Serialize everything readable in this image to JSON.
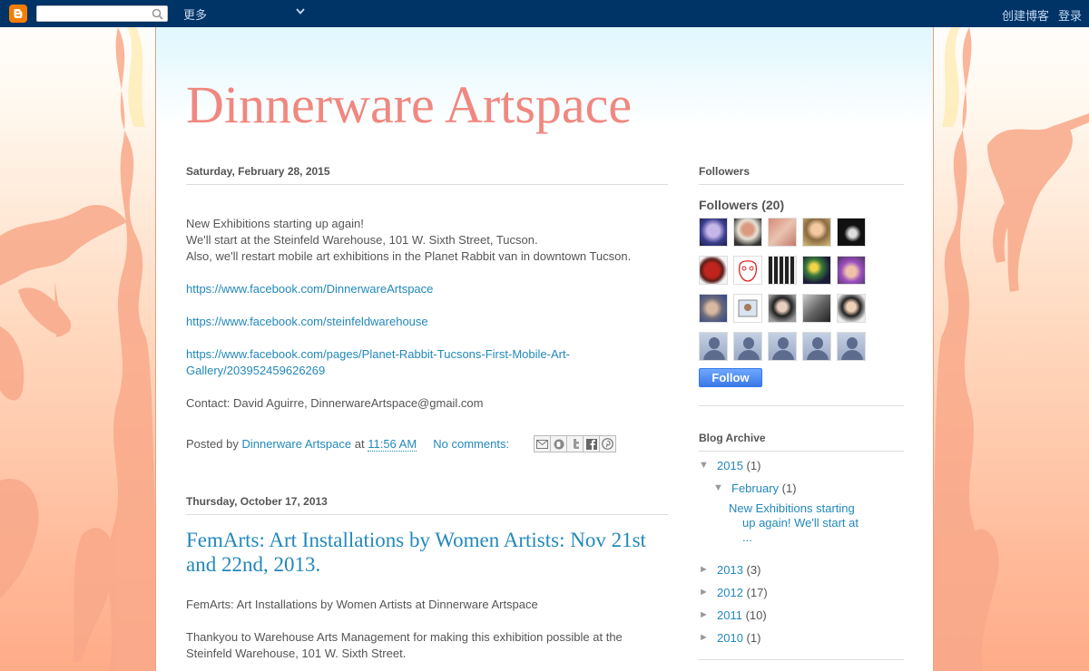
{
  "navbar": {
    "more_label": "更多",
    "create_blog": "创建博客",
    "sign_in": "登录",
    "search_value": ""
  },
  "blog": {
    "title": "Dinnerware Artspace"
  },
  "posts": [
    {
      "date": "Saturday, February 28, 2015",
      "title": "",
      "lines": [
        "New Exhibitions starting up again!",
        "We'll start at the Steinfeld Warehouse, 101 W. Sixth Street, Tucson.",
        "Also, we'll restart mobile art exhibitions in the Planet Rabbit van in downtown Tucson."
      ],
      "link1": "https://www.facebook.com/DinnerwareArtspace",
      "link2": "https://www.facebook.com/steinfeldwarehouse",
      "link3a": "https://www.facebook.com/pages/Planet-Rabbit-Tucsons-First-Mobile-Art-",
      "link3b": "Gallery/203952459626269",
      "contact": "Contact: David Aguirre, DinnerwareArtspace@gmail.com",
      "posted_by_prefix": "Posted by",
      "author": "Dinnerware Artspace",
      "at": "at",
      "time": "11:56 AM",
      "comments": "No comments:"
    },
    {
      "date": "Thursday, October 17, 2013",
      "title": "FemArts: Art Installations by Women Artists: Nov 21st and 22nd, 2013.",
      "line1": "FemArts: Art Installations by Women Artists at Dinnerware Artspace",
      "line2": "Thankyou to Warehouse Arts Management for making this exhibition possible at the",
      "line3": "Steinfeld Warehouse, 101 W. Sixth Street."
    }
  ],
  "sidebar": {
    "followers_title": "Followers",
    "followers_count": "Followers (20)",
    "follow_button": "Follow",
    "archive_title": "Blog Archive",
    "archive": {
      "y2015": {
        "label": "2015",
        "count": "(1)"
      },
      "feb": {
        "label": "February",
        "count": "(1)"
      },
      "post_l1": "New Exhibitions starting",
      "post_l2": "up again! We'll start at",
      "post_l3": "...",
      "y2013": {
        "label": "2013",
        "count": "(3)"
      },
      "y2012": {
        "label": "2012",
        "count": "(17)"
      },
      "y2011": {
        "label": "2011",
        "count": "(10)"
      },
      "y2010": {
        "label": "2010",
        "count": "(1)"
      }
    }
  },
  "colors": {
    "navbar": "#003366",
    "title": "#f08880",
    "link": "#2288bb"
  }
}
